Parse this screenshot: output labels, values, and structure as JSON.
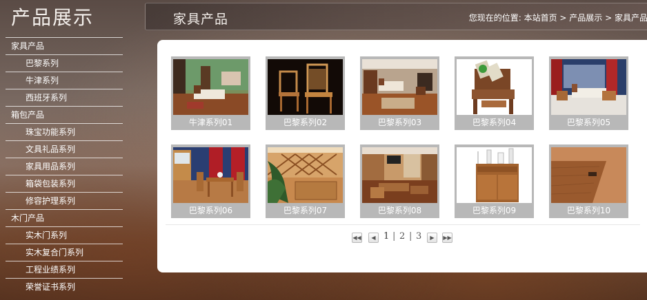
{
  "sidebar": {
    "title": "产品展示",
    "menu": [
      {
        "label": "家具产品",
        "level": "cat"
      },
      {
        "label": "巴黎系列",
        "level": "sub"
      },
      {
        "label": "牛津系列",
        "level": "sub"
      },
      {
        "label": "西班牙系列",
        "level": "sub"
      },
      {
        "label": "箱包产品",
        "level": "cat"
      },
      {
        "label": "珠宝功能系列",
        "level": "sub"
      },
      {
        "label": "文具礼品系列",
        "level": "sub"
      },
      {
        "label": "家具用品系列",
        "level": "sub"
      },
      {
        "label": "箱袋包装系列",
        "level": "sub"
      },
      {
        "label": "修容护理系列",
        "level": "sub"
      },
      {
        "label": "木门产品",
        "level": "cat"
      },
      {
        "label": "实木门系列",
        "level": "sub"
      },
      {
        "label": "实木复合门系列",
        "level": "sub"
      },
      {
        "label": "工程业绩系列",
        "level": "sub"
      },
      {
        "label": "荣誉证书系列",
        "level": "sub"
      }
    ]
  },
  "header": {
    "title": "家具产品",
    "breadcrumb": {
      "prefix": "您现在的位置: ",
      "home": "本站首页",
      "sep": " > ",
      "section": "产品展示",
      "current": "家具产品"
    }
  },
  "products": [
    {
      "caption": "牛津系列01",
      "scene": "bedroom-green"
    },
    {
      "caption": "巴黎系列02",
      "scene": "chairs-dark"
    },
    {
      "caption": "巴黎系列03",
      "scene": "bedroom-warm"
    },
    {
      "caption": "巴黎系列04",
      "scene": "armchair"
    },
    {
      "caption": "巴黎系列05",
      "scene": "bedroom-red"
    },
    {
      "caption": "巴黎系列06",
      "scene": "dining-blue"
    },
    {
      "caption": "巴黎系列07",
      "scene": "wine-rack"
    },
    {
      "caption": "巴黎系列08",
      "scene": "living-room"
    },
    {
      "caption": "巴黎系列09",
      "scene": "sideboard"
    },
    {
      "caption": "巴黎系列10",
      "scene": "wood-detail"
    }
  ],
  "pagination": {
    "first_icon": "first-page-icon",
    "prev_icon": "prev-page-icon",
    "next_icon": "next-page-icon",
    "last_icon": "last-page-icon",
    "pages": [
      "1",
      "2",
      "3"
    ],
    "separator": "|",
    "current_page": "1"
  }
}
